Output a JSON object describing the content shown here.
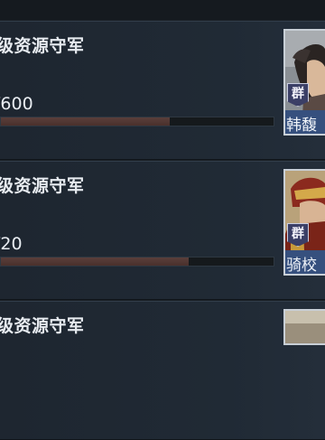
{
  "missions": [
    {
      "title": "级资源守军",
      "progress_text": "/600",
      "progress_fraction": 0.62,
      "hero": {
        "faction": "群",
        "name": "韩馥"
      }
    },
    {
      "title": "级资源守军",
      "progress_text": "/20",
      "progress_fraction": 0.69,
      "hero": {
        "faction": "群",
        "name": "骑校"
      }
    },
    {
      "title": "级资源守军"
    }
  ]
}
